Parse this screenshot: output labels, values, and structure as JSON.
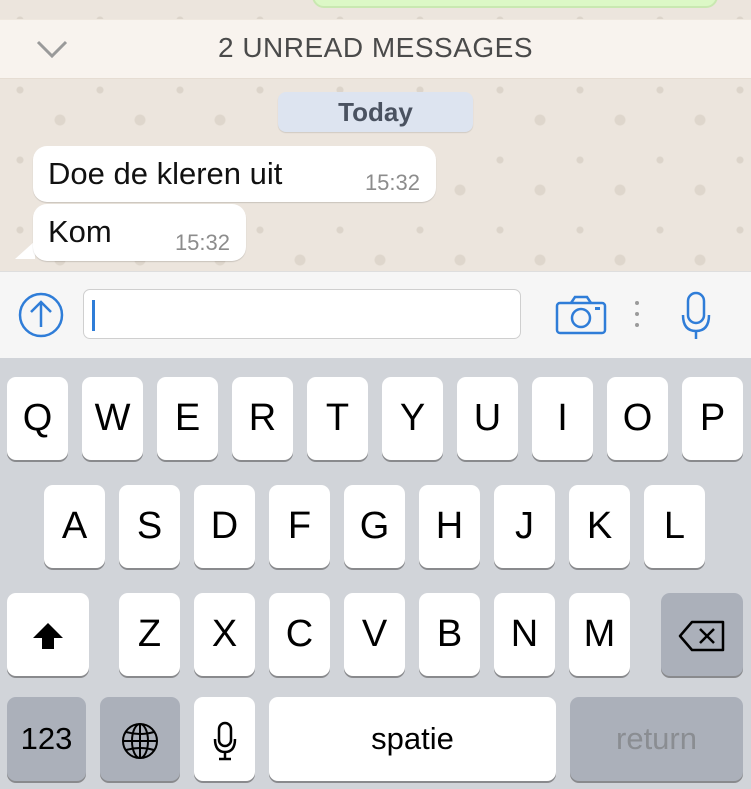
{
  "chat": {
    "unread_banner": "2 UNREAD MESSAGES",
    "date_chip": "Today",
    "messages": [
      {
        "text": "Doe de kleren uit",
        "time": "15:32"
      },
      {
        "text": "Kom",
        "time": "15:32"
      }
    ]
  },
  "input": {
    "value": "",
    "icons": [
      "arrow-up-circle-icon",
      "camera-icon",
      "more-dots-icon",
      "microphone-icon"
    ]
  },
  "keyboard": {
    "row1": [
      "Q",
      "W",
      "E",
      "R",
      "T",
      "Y",
      "U",
      "I",
      "O",
      "P"
    ],
    "row2": [
      "A",
      "S",
      "D",
      "F",
      "G",
      "H",
      "J",
      "K",
      "L"
    ],
    "row3": [
      "Z",
      "X",
      "C",
      "V",
      "B",
      "N",
      "M"
    ],
    "numbers_label": "123",
    "space_label": "spatie",
    "return_label": "return",
    "icons": [
      "shift-icon",
      "backspace-icon",
      "globe-icon",
      "dictation-mic-icon"
    ]
  },
  "colors": {
    "chat_background": "#ece5dd",
    "accent": "#2f7dd8",
    "keyboard_background": "#d1d4d9"
  }
}
